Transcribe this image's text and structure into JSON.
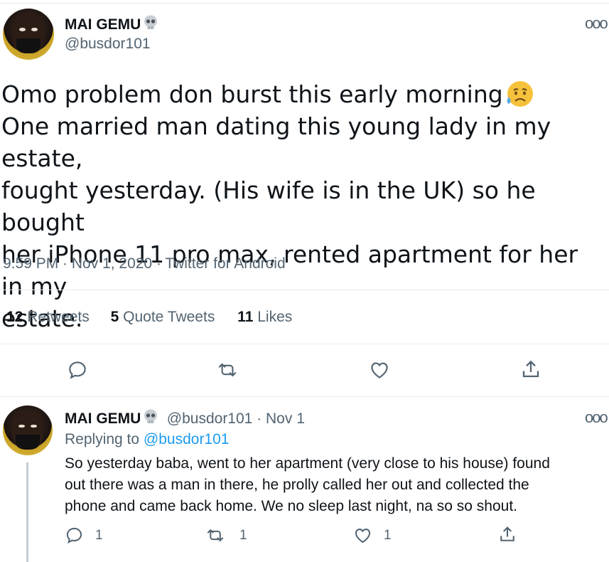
{
  "main_tweet": {
    "display_name": "MAI GEMU",
    "handle": "@busdor101",
    "more_label": "ooo",
    "text_line1": "Omo problem don burst this early morning",
    "text_line2": "One married man dating this young lady in my estate,",
    "text_line3": "fought yesterday. (His wife is in the UK) so he bought",
    "text_line4": "her iPhone 11 pro max, rented apartment for her in my",
    "text_line5": "estate.",
    "timestamp": "9:59 PM · Nov 1, 2020 · Twitter for Android",
    "retweets_count": "12",
    "retweets_label": "Retweets",
    "quotes_count": "5",
    "quotes_label": "Quote Tweets",
    "likes_count": "11",
    "likes_label": "Likes"
  },
  "reply_tweet": {
    "display_name": "MAI GEMU",
    "handle_date": "@busdor101 · Nov 1",
    "more_label": "ooo",
    "replying_prefix": "Replying to",
    "replying_handle": "@busdor101",
    "text_line1": "So yesterday baba, went to her apartment (very close to his house) found",
    "text_line2": "out there was a man in there, he prolly called her out and collected the",
    "text_line3": "phone and came back home. We no sleep last night, na so so shout.",
    "reply_count": "1",
    "retweet_count": "1",
    "like_count": "1"
  },
  "colors": {
    "accent": "#1d9bf0",
    "secondary_text": "#536471",
    "divider": "#e6ecf0"
  },
  "icons": [
    "skull-emoji-icon",
    "sad-sweat-emoji-icon",
    "reply-icon",
    "retweet-icon",
    "like-icon",
    "share-icon",
    "more-icon"
  ]
}
